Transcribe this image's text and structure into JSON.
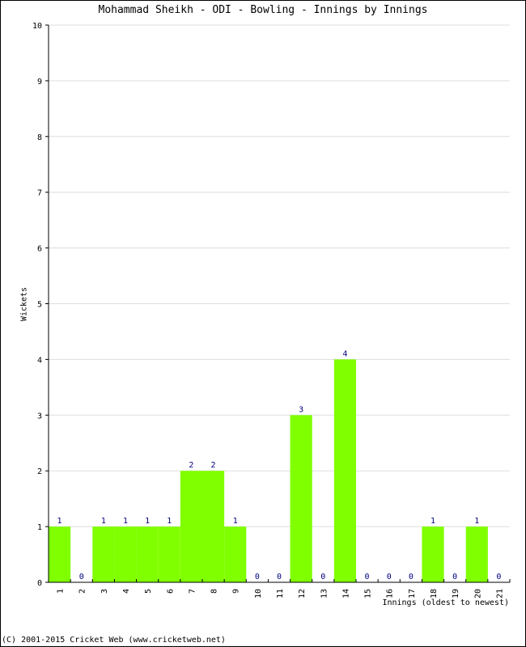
{
  "chart_data": {
    "type": "bar",
    "title": "Mohammad Sheikh - ODI - Bowling - Innings by Innings",
    "xlabel": "Innings (oldest to newest)",
    "ylabel": "Wickets",
    "ylim": [
      0,
      10
    ],
    "yticks": [
      0,
      1,
      2,
      3,
      4,
      5,
      6,
      7,
      8,
      9,
      10
    ],
    "grid": true,
    "categories": [
      "1",
      "2",
      "3",
      "4",
      "5",
      "6",
      "7",
      "8",
      "9",
      "10",
      "11",
      "12",
      "13",
      "14",
      "15",
      "16",
      "17",
      "18",
      "19",
      "20",
      "21"
    ],
    "values": [
      1,
      0,
      1,
      1,
      1,
      1,
      2,
      2,
      1,
      0,
      0,
      3,
      0,
      4,
      0,
      0,
      0,
      1,
      0,
      1,
      0
    ],
    "bar_color": "#80ff00",
    "label_color": "#00007f",
    "grid_color": "#dddddd"
  },
  "footer": {
    "copyright": "(C) 2001-2015 Cricket Web (www.cricketweb.net)"
  }
}
